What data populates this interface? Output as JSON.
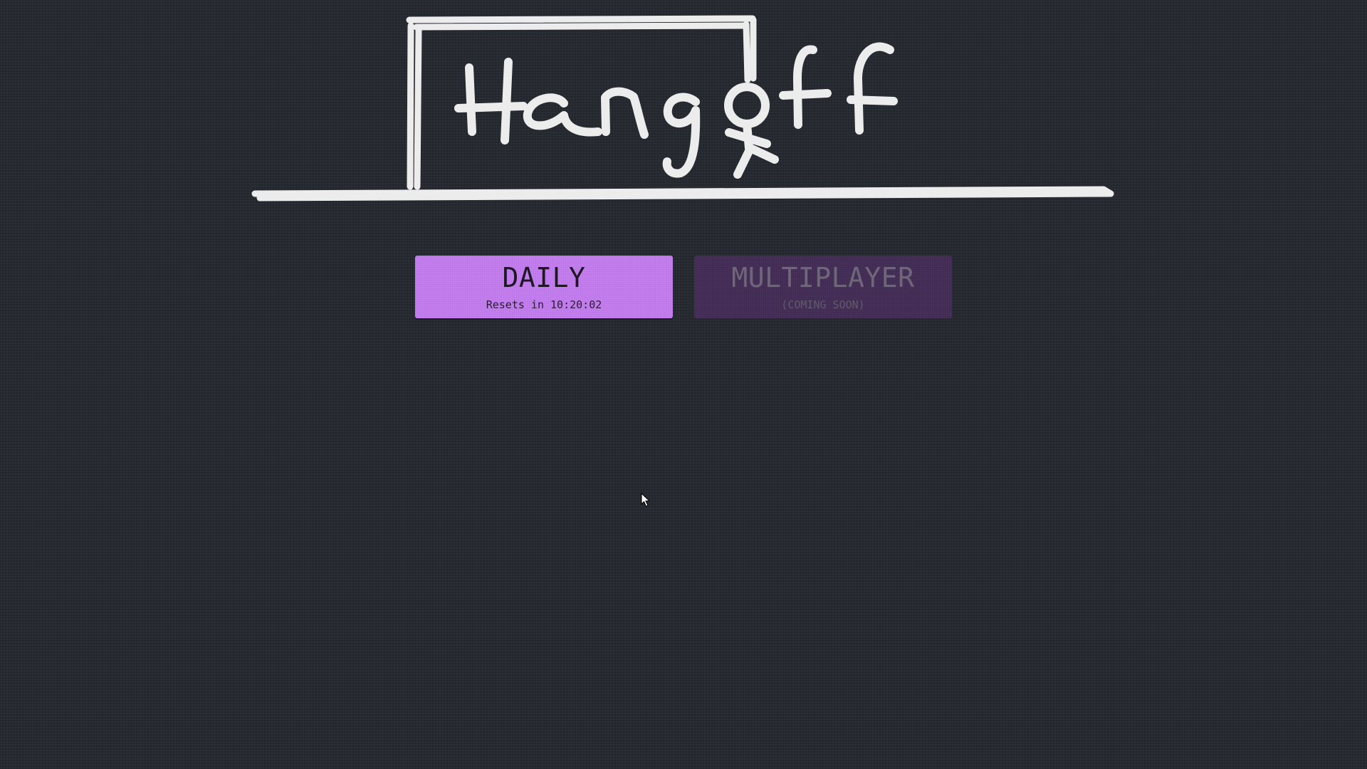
{
  "logo": {
    "text": "Hangoff",
    "stroke_color": "#ececec"
  },
  "modes": {
    "daily": {
      "label": "DAILY",
      "subtitle": "Resets in 10:20:02",
      "color": "#c57ef0",
      "enabled": true
    },
    "multiplayer": {
      "label": "MULTIPLAYER",
      "subtitle": "(COMING SOON)",
      "color": "#47305a",
      "enabled": false
    }
  },
  "theme": {
    "background": "#262a31"
  },
  "cursor": {
    "icon": "pointer-cursor-icon"
  }
}
